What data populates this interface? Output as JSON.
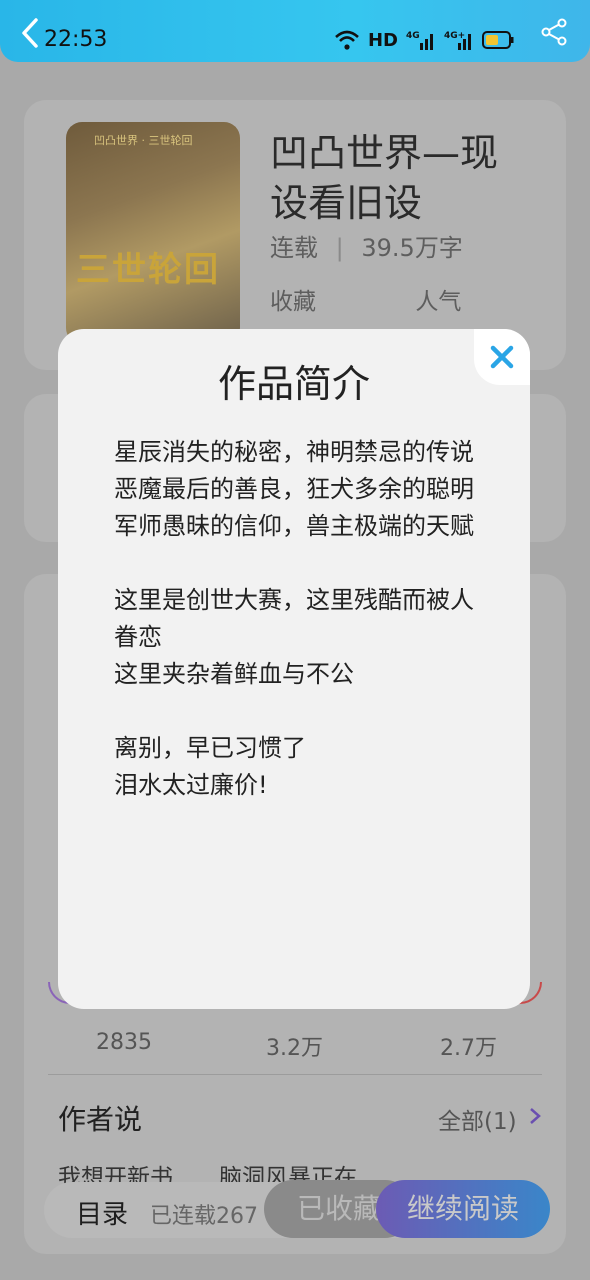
{
  "status_bar": {
    "time": "22:53",
    "hd_label": "HD",
    "net1": "4G",
    "net2": "4G+"
  },
  "book": {
    "title": "凹凸世界—现设看旧设",
    "cover_title": "三世轮回",
    "status": "连载",
    "word_count": "39.5万字",
    "favorites_label": "收藏",
    "popularity_label": "人气"
  },
  "stats": {
    "values": [
      "2835",
      "3.2万",
      "2.7万"
    ]
  },
  "author_section": {
    "title": "作者说",
    "all_label": "全部(1)",
    "preview": "我想开新书……脑洞风暴正在…"
  },
  "bottom_bar": {
    "toc_label": "目录",
    "serial_label": "已连载267",
    "favorited_label": "已收藏",
    "continue_label": "继续阅读"
  },
  "modal": {
    "title": "作品简介",
    "paragraphs": [
      "星辰消失的秘密，神明禁忌的传说",
      "恶魔最后的善良，狂犬多余的聪明",
      "军师愚昧的信仰，兽主极端的天赋",
      "",
      "这里是创世大赛，这里残酷而被人眷恋",
      "这里夹杂着鲜血与不公",
      "",
      "离别，早已习惯了",
      "泪水太过廉价!"
    ]
  },
  "colors": {
    "status_bar": "#36c6ef",
    "close_icon": "#2aa5e6",
    "modal_bg": "#f2f2f2",
    "overlay": "#a9a9a9"
  }
}
